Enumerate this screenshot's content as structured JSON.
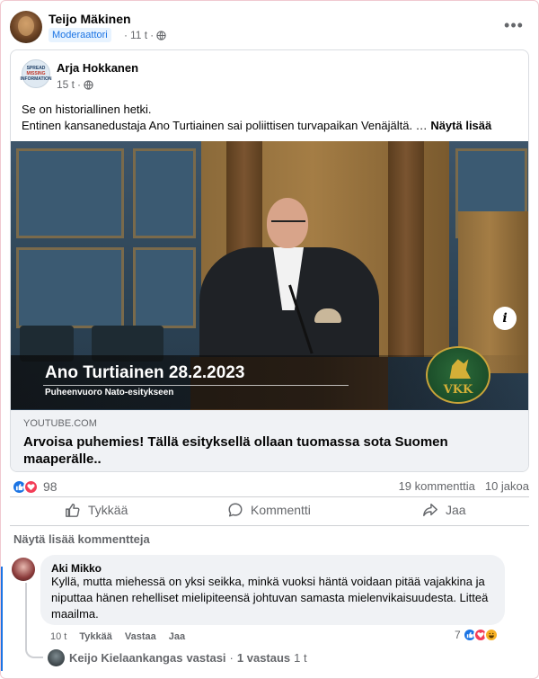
{
  "post": {
    "author": "Teijo Mäkinen",
    "badge": "Moderaattori",
    "time": "11 t",
    "separator": "·",
    "more_icon": "ellipsis-icon"
  },
  "shared": {
    "author": "Arja Hokkanen",
    "avatar_text": [
      "SPREAD",
      "MISSING",
      "INFORMATION"
    ],
    "time": "15 t",
    "separator": "·",
    "text_line1": "Se on historiallinen hetki.",
    "text_line2": "Entinen kansanedustaja Ano Turtiainen sai poliittisen turvapaikan Venäjältä. …",
    "see_more": "Näytä lisää"
  },
  "video": {
    "title": "Ano Turtiainen 28.2.2023",
    "subtitle": "Puheenvuoro Nato-esitykseen",
    "logo_text": "VKK",
    "info_icon": "i"
  },
  "link": {
    "domain": "YOUTUBE.COM",
    "title": "Arvoisa puhemies! Tällä esityksellä ollaan tuomassa sota Suomen maaperälle.."
  },
  "stats": {
    "reaction_count": "98",
    "comments": "19 kommenttia",
    "shares": "10 jakoa",
    "colors": {
      "like": "#1b74e4",
      "love": "#f33e58"
    }
  },
  "actions": {
    "like": "Tykkää",
    "comment": "Kommentti",
    "share": "Jaa"
  },
  "more_comments": "Näytä lisää kommentteja",
  "comment": {
    "author": "Aki Mikko",
    "text": "Kyllä, mutta miehessä on yksi seikka, minkä vuoksi häntä voidaan pitää vajakkina ja niputtaa hänen rehelliset mielipiteensä johtuvan samasta mielenvikaisuudesta. Litteä maailma.",
    "time": "10 t",
    "like": "Tykkää",
    "reply": "Vastaa",
    "share": "Jaa",
    "reaction_count": "7"
  },
  "reply": {
    "author": "Keijo Kielaankangas",
    "action": "vastasi",
    "separator": "·",
    "count": "1 vastaus",
    "time": "1 t"
  }
}
